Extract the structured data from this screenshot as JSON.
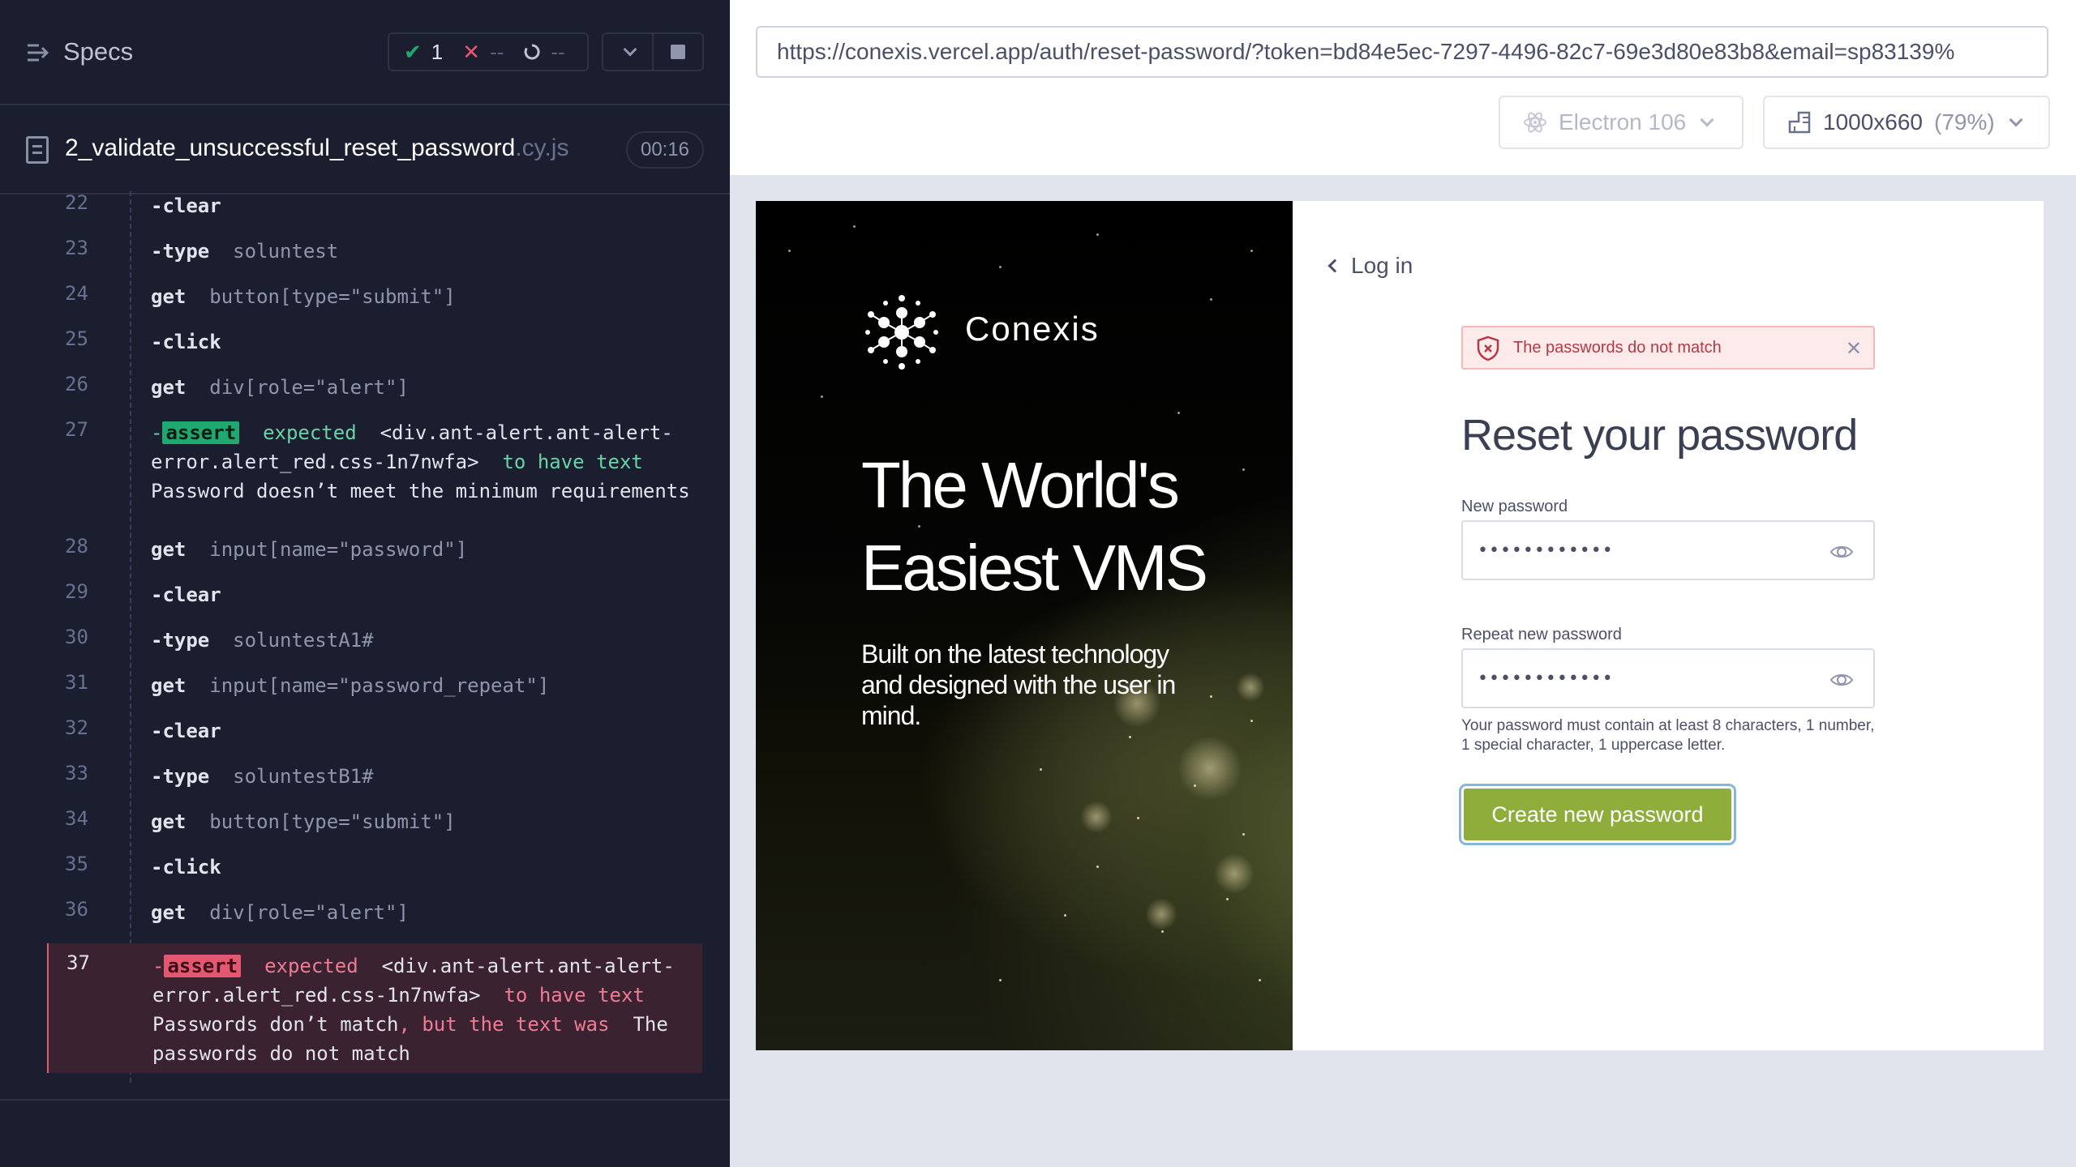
{
  "runner": {
    "specs_label": "Specs",
    "stats": {
      "passed": "1",
      "failed": "--",
      "pending": "--"
    },
    "spec": {
      "name": "2_validate_unsuccessful_reset_password",
      "ext": ".cy.js",
      "duration": "00:16"
    },
    "commands": [
      {
        "line": "22",
        "name": "-clear",
        "message": ""
      },
      {
        "line": "23",
        "name": "-type",
        "message": "soluntest"
      },
      {
        "line": "24",
        "name": "get",
        "message": "button[type=\"submit\"]"
      },
      {
        "line": "25",
        "name": "-click",
        "message": ""
      },
      {
        "line": "26",
        "name": "get",
        "message": "div[role=\"alert\"]"
      },
      {
        "line": "27",
        "assert": true,
        "prefix": "-",
        "tag": "assert",
        "expected": "expected",
        "selector": "<div.ant-alert.ant-alert-error.alert_red.css-1n7nwfa>",
        "to_have": "to have text",
        "text": "Password doesn’t meet the minimum requirements"
      },
      {
        "line": "28",
        "name": "get",
        "message": "input[name=\"password\"]"
      },
      {
        "line": "29",
        "name": "-clear",
        "message": ""
      },
      {
        "line": "30",
        "name": "-type",
        "message": "soluntestA1#"
      },
      {
        "line": "31",
        "name": "get",
        "message": "input[name=\"password_repeat\"]"
      },
      {
        "line": "32",
        "name": "-clear",
        "message": ""
      },
      {
        "line": "33",
        "name": "-type",
        "message": "soluntestB1#"
      },
      {
        "line": "34",
        "name": "get",
        "message": "button[type=\"submit\"]"
      },
      {
        "line": "35",
        "name": "-click",
        "message": ""
      },
      {
        "line": "36",
        "name": "get",
        "message": "div[role=\"alert\"]"
      },
      {
        "line": "37",
        "assert": true,
        "failed": true,
        "prefix": "-",
        "tag": "assert",
        "expected": "expected",
        "selector": "<div.ant-alert.ant-alert-error.alert_red.css-1n7nwfa>",
        "to_have": "to have text",
        "text": "Passwords don’t match",
        "but": ", but the text was",
        "actual": "The passwords do not match"
      }
    ]
  },
  "aut": {
    "url": "https://conexis.vercel.app/auth/reset-password/?token=bd84e5ec-7297-4496-82c7-69e3d80e83b8&email=sp83139%",
    "browser": "Electron 106",
    "viewport": "1000x660",
    "zoom": "(79%)"
  },
  "app": {
    "brand": "Conexis",
    "headline": "The World's Easiest VMS",
    "subline": "Built on the latest technology and designed with the user in mind.",
    "back_link": "Log in",
    "alert": "The passwords do not match",
    "title": "Reset your password",
    "new_password_label": "New password",
    "new_password_value": "••••••••••••",
    "repeat_password_label": "Repeat new password",
    "repeat_password_value": "••••••••••••",
    "hint": "Your password must contain at least 8 characters, 1 number, 1 special character, 1 uppercase letter.",
    "submit": "Create new password"
  },
  "colors": {
    "runner_bg": "#1b1e2e",
    "pass": "#1fa971",
    "fail": "#e45770",
    "brand_green": "#8fad3b",
    "alert_bg": "#fdeaea"
  }
}
